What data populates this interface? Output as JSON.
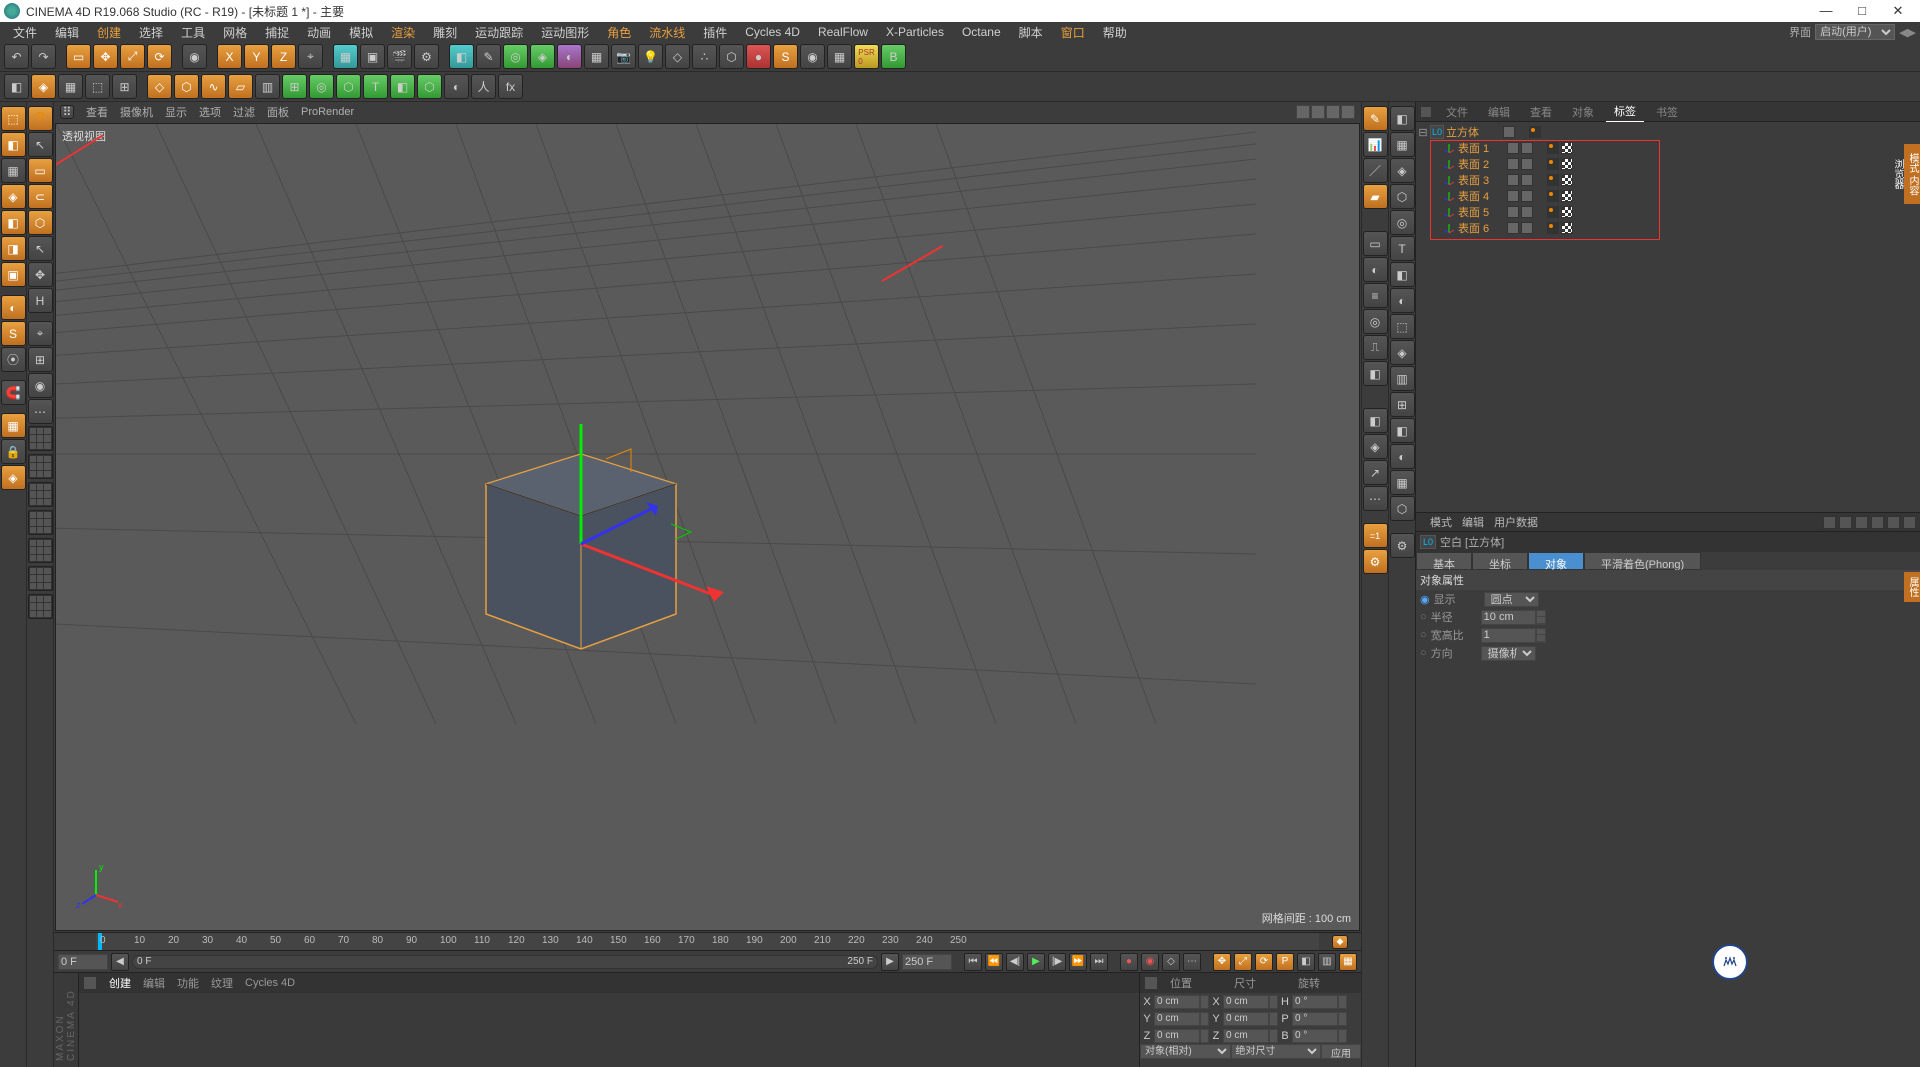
{
  "title": "CINEMA 4D R19.068 Studio (RC - R19) - [未标题 1 *] - 主要",
  "menu": [
    "文件",
    "编辑",
    "创建",
    "选择",
    "工具",
    "网格",
    "捕捉",
    "动画",
    "模拟",
    "渲染",
    "雕刻",
    "运动跟踪",
    "运动图形",
    "角色",
    "流水线",
    "插件",
    "Cycles 4D",
    "RealFlow",
    "X-Particles",
    "Octane",
    "脚本",
    "窗口",
    "帮助"
  ],
  "layout_label": "界面",
  "layout_value": "启动(用户)",
  "vp_menu": [
    "查看",
    "摄像机",
    "显示",
    "选项",
    "过滤",
    "面板",
    "ProRender"
  ],
  "vp_label": "透视视图",
  "vp_info": "网格间距 : 100 cm",
  "timeline": {
    "start": "0 F",
    "scrub_left": "0 F",
    "scrub_right": "250 F",
    "end": "250 F",
    "ticks": [
      0,
      10,
      20,
      30,
      40,
      50,
      60,
      70,
      80,
      90,
      100,
      110,
      120,
      130,
      140,
      150,
      160,
      170,
      180,
      190,
      200,
      210,
      220,
      230,
      240,
      250
    ]
  },
  "bottom_tabs": [
    "创建",
    "编辑",
    "功能",
    "纹理",
    "Cycles 4D"
  ],
  "rp_tabs": [
    "文件",
    "编辑",
    "查看",
    "对象",
    "标签",
    "书签"
  ],
  "tree_root": "立方体",
  "tree_children": [
    "表面 1",
    "表面 2",
    "表面 3",
    "表面 4",
    "表面 5",
    "表面 6"
  ],
  "attr_tabs": [
    "模式",
    "编辑",
    "用户数据"
  ],
  "attr_header": "空白 [立方体]",
  "subtabs": [
    "基本",
    "坐标",
    "对象",
    "平滑着色(Phong)"
  ],
  "prop_section": "对象属性",
  "props": {
    "display_label": "显示",
    "display_value": "圆点",
    "radius_label": "半径",
    "radius_value": "10 cm",
    "aspect_label": "宽高比",
    "aspect_value": "1",
    "orient_label": "方向",
    "orient_value": "摄像机"
  },
  "coord": {
    "hdr": [
      "位置",
      "尺寸",
      "旋转"
    ],
    "rows": [
      {
        "l": "X",
        "p": "0 cm",
        "s": "0 cm",
        "r": "0 °",
        "sl": "X",
        "rl": "H"
      },
      {
        "l": "Y",
        "p": "0 cm",
        "s": "0 cm",
        "r": "0 °",
        "sl": "Y",
        "rl": "P"
      },
      {
        "l": "Z",
        "p": "0 cm",
        "s": "0 cm",
        "r": "0 °",
        "sl": "Z",
        "rl": "B"
      }
    ],
    "sel1": "对象(相对)",
    "sel2": "绝对尺寸",
    "apply": "应用"
  },
  "vtab1": "模式 内容浏览器",
  "vtab2": "属性"
}
